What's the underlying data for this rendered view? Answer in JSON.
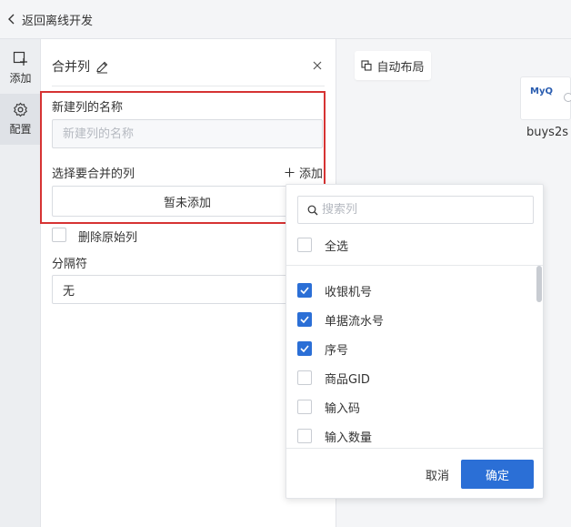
{
  "topbar": {
    "back_label": "返回离线开发"
  },
  "rail": {
    "add_label": "添加",
    "config_label": "配置"
  },
  "panel": {
    "title": "合并列",
    "new_col_label": "新建列的名称",
    "new_col_placeholder": "新建列的名称",
    "select_cols_label": "选择要合并的列",
    "add_label": "添加",
    "empty_text": "暂未添加",
    "delete_original_label": "删除原始列",
    "separator_label": "分隔符",
    "separator_value": "无"
  },
  "canvas": {
    "auto_layout_label": "自动布局",
    "node_label": "buys2s",
    "node_logo_text": "MyQ"
  },
  "dropdown": {
    "search_placeholder": "搜索列",
    "select_all_label": "全选",
    "items": [
      {
        "label": "收银机号",
        "checked": true
      },
      {
        "label": "单据流水号",
        "checked": true
      },
      {
        "label": "序号",
        "checked": true
      },
      {
        "label": "商品GID",
        "checked": false
      },
      {
        "label": "输入码",
        "checked": false
      },
      {
        "label": "输入数量",
        "checked": false
      }
    ],
    "cancel_label": "取消",
    "confirm_label": "确定"
  },
  "colors": {
    "accent": "#2b6fd6",
    "highlight": "#d63333"
  }
}
